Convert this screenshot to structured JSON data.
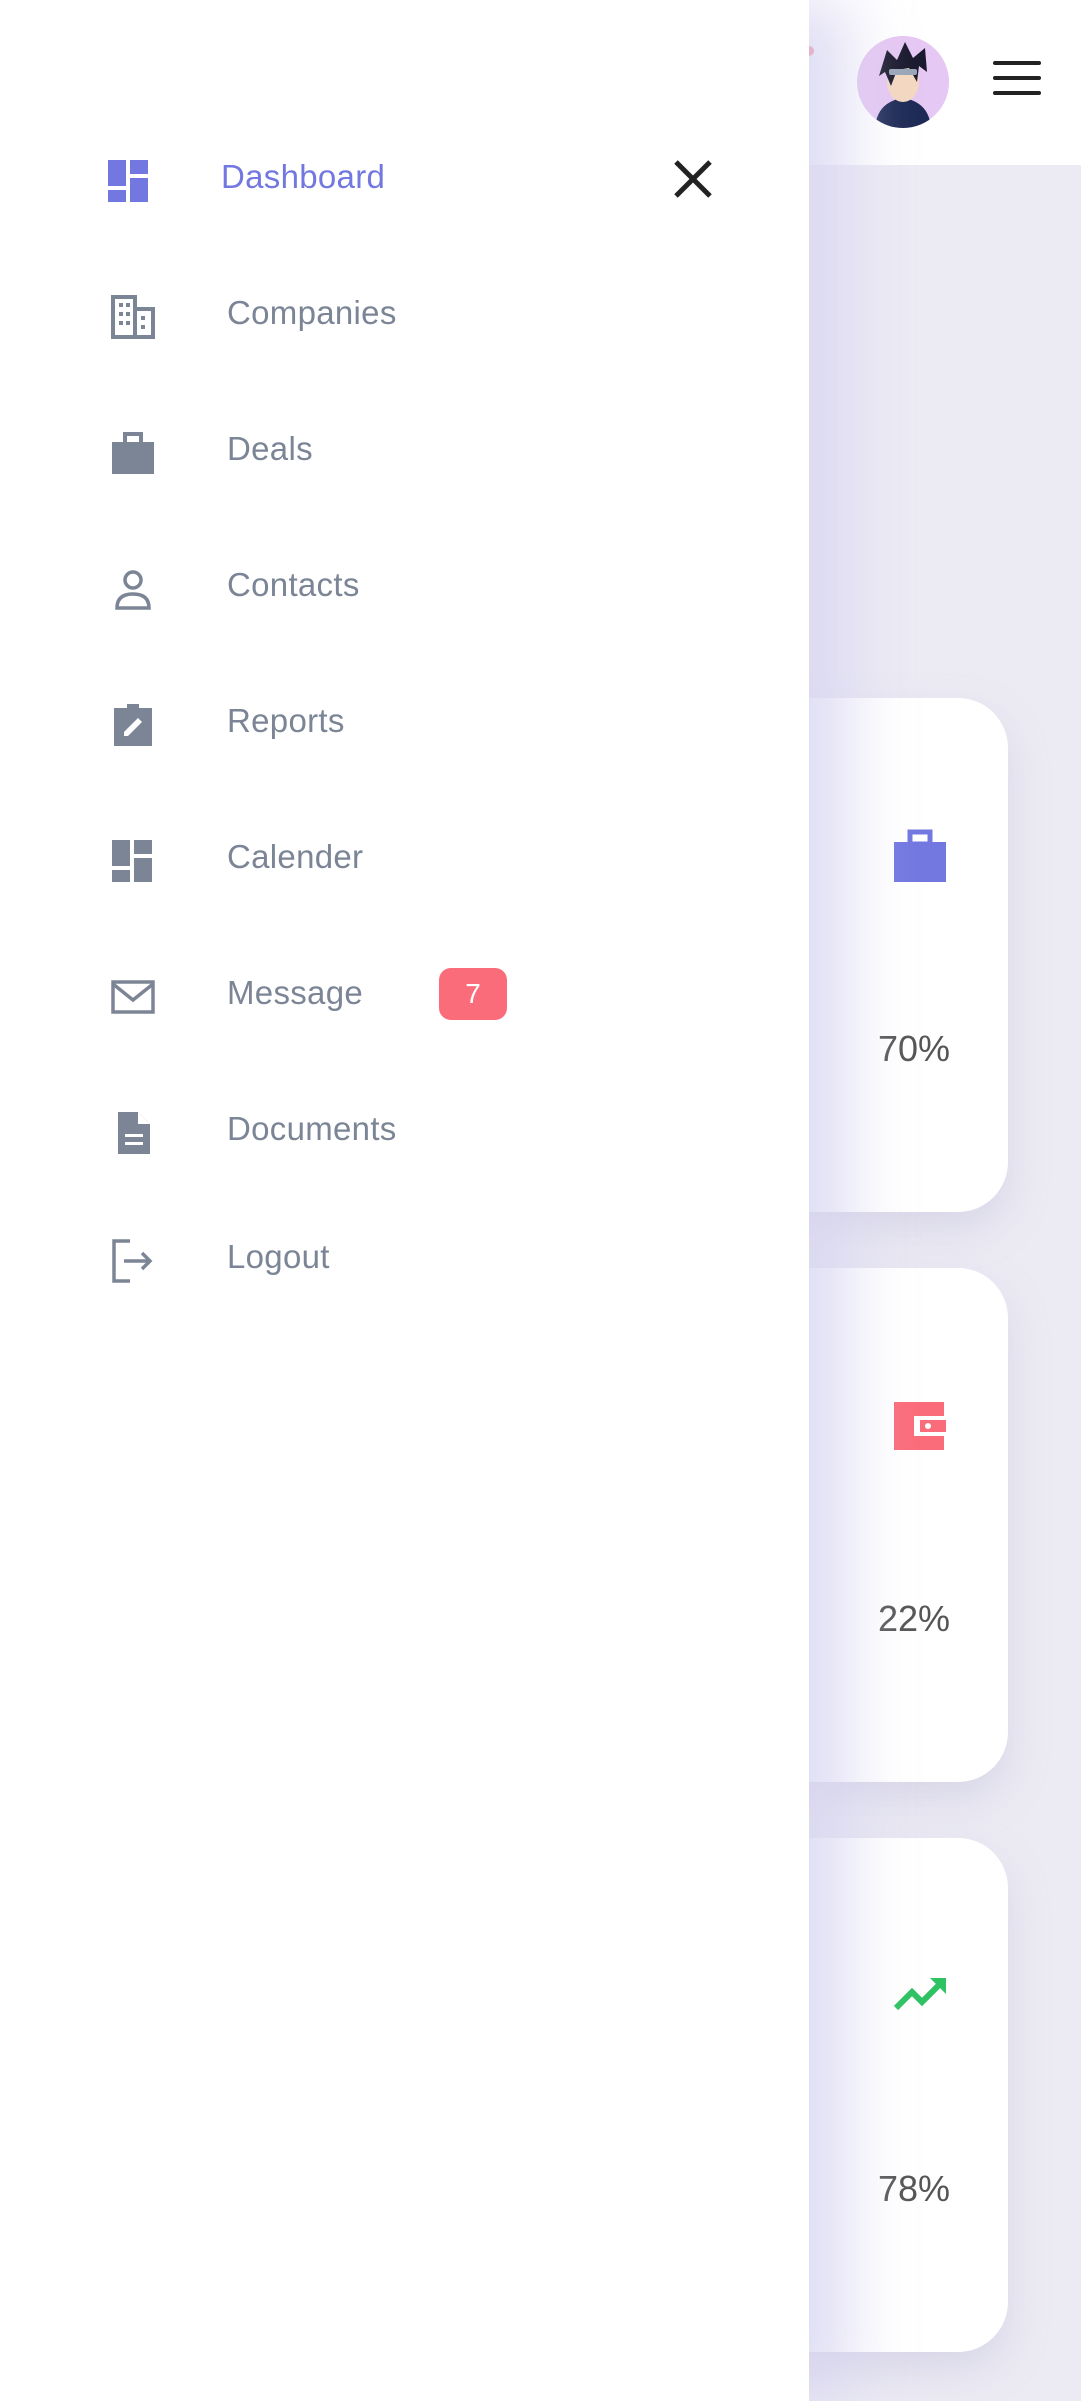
{
  "sidebar": {
    "items": [
      {
        "label": "Dashboard",
        "icon": "dashboard-icon",
        "active": true
      },
      {
        "label": "Companies",
        "icon": "building-icon"
      },
      {
        "label": "Deals",
        "icon": "briefcase-icon"
      },
      {
        "label": "Contacts",
        "icon": "person-icon"
      },
      {
        "label": "Reports",
        "icon": "report-icon"
      },
      {
        "label": "Calender",
        "icon": "calendar-icon"
      },
      {
        "label": "Message",
        "icon": "mail-icon",
        "badge": "7"
      },
      {
        "label": "Documents",
        "icon": "document-icon"
      },
      {
        "label": "Logout",
        "icon": "logout-icon"
      }
    ],
    "close_icon": "close-icon"
  },
  "cards": [
    {
      "value": "70%",
      "icon": "briefcase-icon",
      "color": "#7278e0"
    },
    {
      "value": "22%",
      "icon": "wallet-icon",
      "color": "#fb6c7a"
    },
    {
      "value": "78%",
      "icon": "trending-up-icon",
      "color": "#2ec262"
    }
  ],
  "colors": {
    "accent": "#7278e0",
    "muted": "#7b8596",
    "badge": "#fb6c7a"
  }
}
